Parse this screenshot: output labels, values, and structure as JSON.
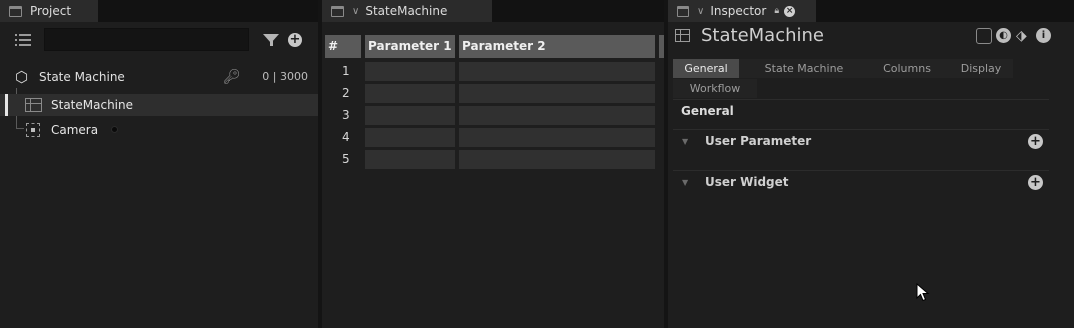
{
  "project": {
    "tab_label": "Project",
    "search_value": "",
    "tree": {
      "root_label": "State Machine",
      "range": "0 | 3000",
      "children": [
        {
          "label": "StateMachine"
        },
        {
          "label": "Camera"
        }
      ]
    }
  },
  "state_machine": {
    "tab_label": "StateMachine",
    "columns": [
      "#",
      "Parameter 1",
      "Parameter 2"
    ],
    "rows": [
      "1",
      "2",
      "3",
      "4",
      "5"
    ]
  },
  "inspector": {
    "tab_label": "Inspector",
    "title": "StateMachine",
    "tabs": [
      "General",
      "State Machine",
      "Columns",
      "Display",
      "Workflow"
    ],
    "active_tab": "General",
    "section_title": "General",
    "subsections": [
      {
        "label": "User Parameter"
      },
      {
        "label": "User Widget"
      }
    ]
  },
  "icons": {
    "tab_panel": "panel-icon",
    "list": "list-icon",
    "filter": "filter-icon",
    "add": "add-icon",
    "root": "hexagon-icon",
    "key": "key-icon",
    "table": "table-icon",
    "camera": "camera-icon",
    "lock": "lock-icon",
    "close": "close-icon",
    "tag": "tag-icon",
    "info": "info-icon"
  }
}
